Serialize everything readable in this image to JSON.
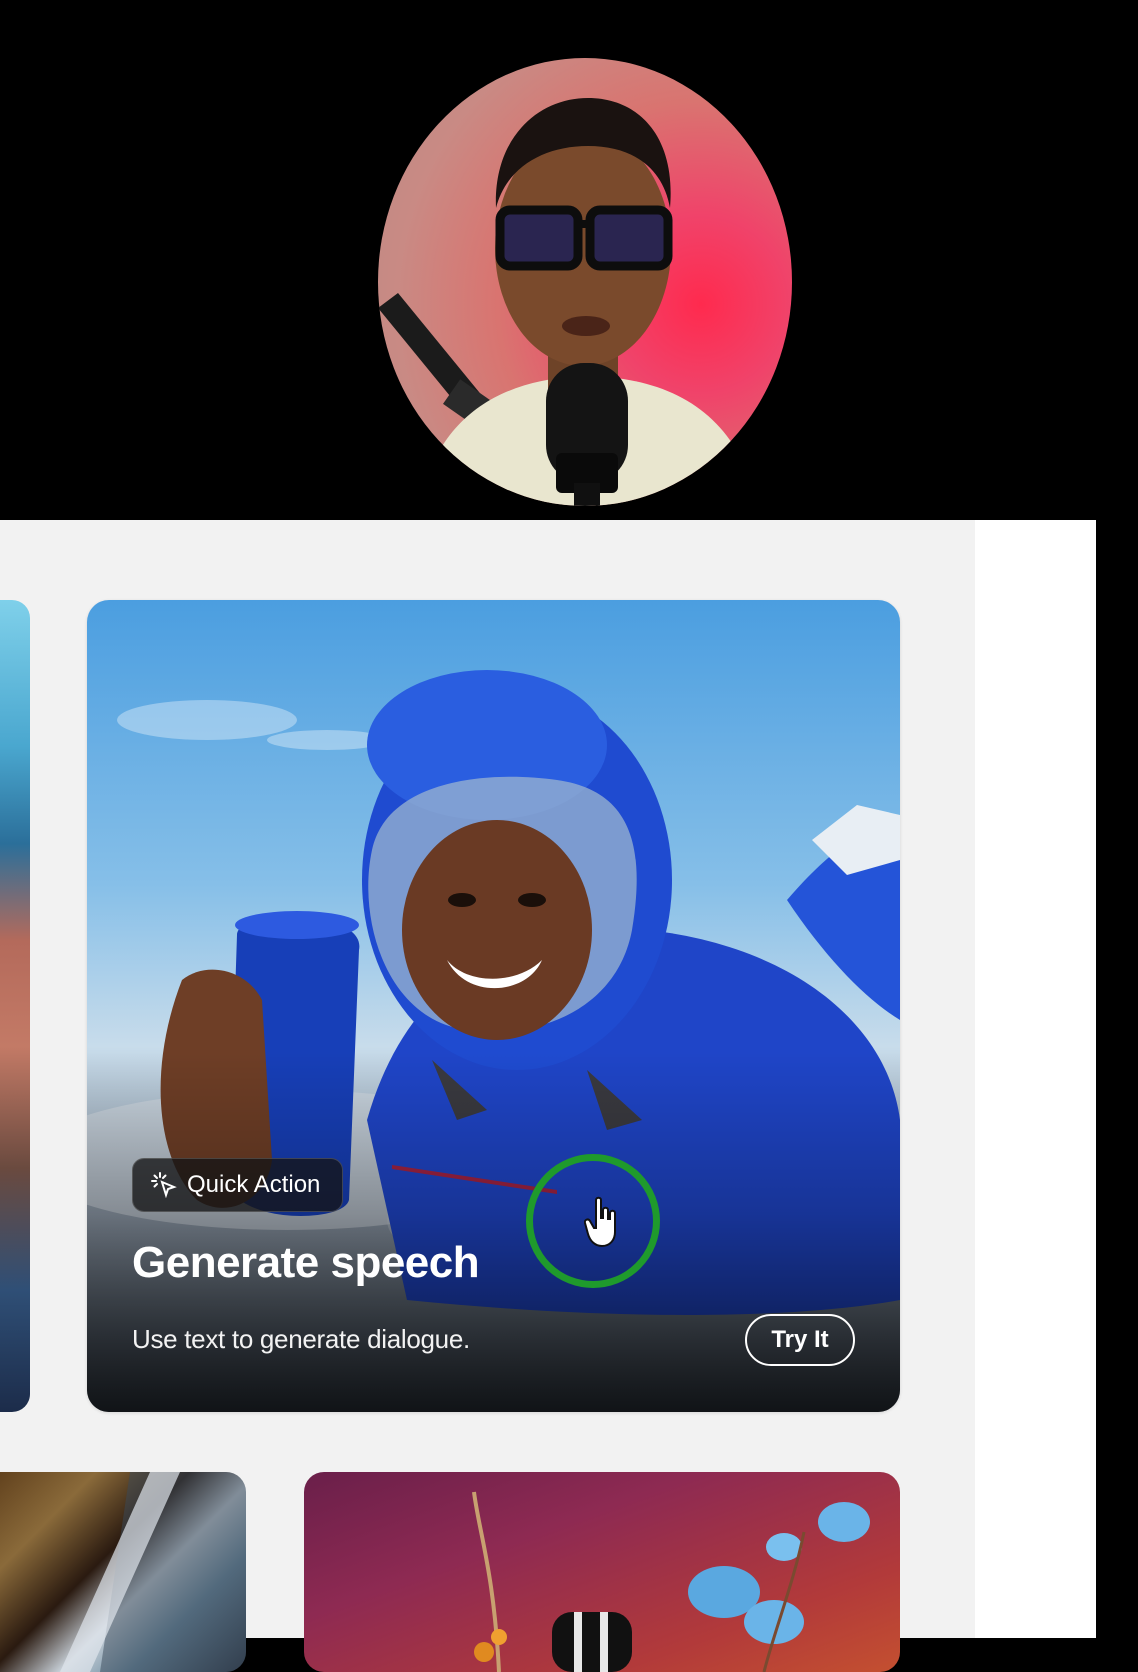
{
  "webcam": {
    "icon": "presenter-webcam"
  },
  "feature_card": {
    "badge_label": "Quick Action",
    "badge_icon": "sparkle-cursor-icon",
    "title": "Generate speech",
    "description": "Use text to generate dialogue.",
    "cta_label": "Try It"
  },
  "colors": {
    "panel_bg": "#f2f2f2",
    "click_ring": "#1f9a2c",
    "sky_top": "#4b9ee0",
    "suit_blue": "#1f45c8"
  }
}
